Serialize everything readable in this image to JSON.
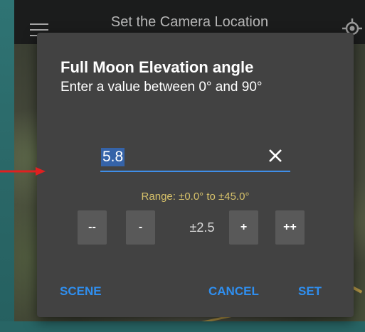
{
  "appbar": {
    "title": "Set the Camera Location",
    "menu_icon": "hamburger-menu-icon",
    "locate_icon": "crosshair-locate-icon"
  },
  "dialog": {
    "title": "Full Moon Elevation angle",
    "subtitle": "Enter a value between 0° and 90°",
    "input": {
      "value": "5.8",
      "clear_icon": "close-icon"
    },
    "range_text": "Range: ±0.0° to ±45.0°",
    "steppers": {
      "decrease_large_label": "--",
      "decrease_label": "-",
      "step_size_label": "±2.5",
      "increase_label": "+",
      "increase_large_label": "++"
    },
    "actions": {
      "scene_label": "SCENE",
      "cancel_label": "CANCEL",
      "set_label": "SET"
    }
  },
  "colors": {
    "accent": "#2f8ff0",
    "dialog_bg": "#424242",
    "range_text": "#d6c16a",
    "annotation_arrow": "#e02020",
    "slide_border": "#2c6b6b"
  }
}
